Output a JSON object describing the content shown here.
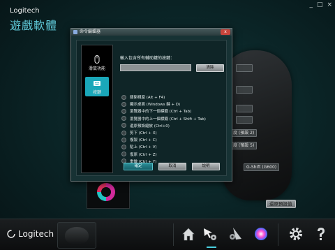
{
  "app": {
    "brand_small": "Logitech",
    "brand_big": "遊戲軟體",
    "window_controls": [
      "_",
      "□",
      "×"
    ]
  },
  "background_labels": [
    {
      "id": "bg-blank-1",
      "text": ""
    },
    {
      "id": "bg-blank-2",
      "text": ""
    },
    {
      "id": "bg-blank-3",
      "text": ""
    },
    {
      "id": "bg-blank-4",
      "text": ""
    },
    {
      "id": "bg-dpi-up",
      "text": "度 (預設 2)"
    },
    {
      "id": "bg-dpi-down",
      "text": "度 (預設 5)"
    },
    {
      "id": "bg-gshift",
      "text": "G-Shift (G600)"
    }
  ],
  "restore_defaults_label": "還原預設值",
  "dialog": {
    "title": "命令編輯器",
    "close_label": "x",
    "nav": [
      {
        "label": "滑鼠功能",
        "icon": "mouse-icon",
        "active": false
      },
      {
        "label": "按鍵",
        "icon": "keyboard-icon",
        "active": true
      }
    ],
    "prompt": "輸入包含所有輔助鍵的按鍵：",
    "keys_value": "",
    "clear_label": "清除",
    "shortcuts": [
      "關閉視窗 (Alt + F4)",
      "顯示桌面 (Windows 鍵 + D)",
      "瀏覽器中的下一個標籤 (Ctrl + Tab)",
      "瀏覽器中的上一個標籤 (Ctrl + Shift + Tab)",
      "還原預設縮放 (Ctrl+0)",
      "剪下 (Ctrl + X)",
      "複製 (Ctrl + C)",
      "貼上 (Ctrl + V)",
      "復原 (Ctrl + Z)",
      "重做 (Ctrl + Y)"
    ],
    "ok_label": "確定",
    "cancel_label": "取消",
    "help_label": "說明"
  },
  "bottom": {
    "logo_text": "Logitech",
    "icons": [
      "home-icon",
      "pointer-settings-icon",
      "mouse-gear-icon",
      "lighting-icon",
      "settings-gear-icon",
      "help-icon"
    ]
  },
  "colors": {
    "accent": "#1aa7b9",
    "brand_cyan": "#5fc7d6",
    "close_red": "#c8453c"
  }
}
